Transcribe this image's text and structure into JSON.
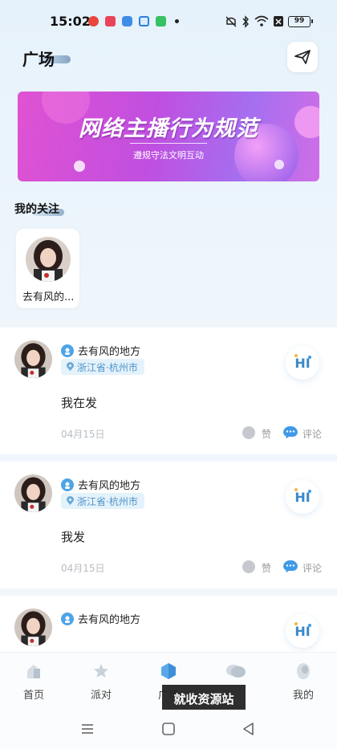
{
  "status_bar": {
    "time": "15:02",
    "battery": "99",
    "notification_icons": [
      {
        "name": "app-icon-red",
        "color": "#e8483c"
      },
      {
        "name": "video-app-icon",
        "color": "#e94459"
      },
      {
        "name": "app-icon-blue",
        "color": "#3e8de6"
      },
      {
        "name": "search-app-icon",
        "color": "#2f7fe0"
      },
      {
        "name": "app-icon-green",
        "color": "#36c163"
      }
    ]
  },
  "header": {
    "title": "广场",
    "send_icon": "paper-plane-icon"
  },
  "banner": {
    "title": "网络主播行为规范",
    "subtitle": "遵规守法文明互动"
  },
  "following": {
    "title": "我的关注",
    "items": [
      {
        "name": "去有风的..."
      }
    ]
  },
  "posts": [
    {
      "username": "去有风的地方",
      "location": "浙江省·杭州市",
      "text": "我在发",
      "date": "04月15日",
      "like_label": "赞",
      "comment_label": "评论",
      "hi_label": "HI"
    },
    {
      "username": "去有风的地方",
      "location": "浙江省·杭州市",
      "text": "我发",
      "date": "04月15日",
      "like_label": "赞",
      "comment_label": "评论",
      "hi_label": "HI"
    },
    {
      "username": "去有风的地方",
      "hi_label": "HI"
    }
  ],
  "bottom_nav": {
    "items": [
      {
        "label": "首页",
        "icon": "home-icon"
      },
      {
        "label": "派对",
        "icon": "star-icon"
      },
      {
        "label": "广场",
        "icon": "hexagon-icon",
        "active": true
      },
      {
        "label": "",
        "icon": "message-icon"
      },
      {
        "label": "我的",
        "icon": "profile-icon"
      }
    ]
  },
  "watermark": "就收资源站",
  "colors": {
    "accent": "#3f9ae6",
    "banner_start": "#e052d2",
    "banner_end": "#a56ff0",
    "location_text": "#4e93c7"
  }
}
